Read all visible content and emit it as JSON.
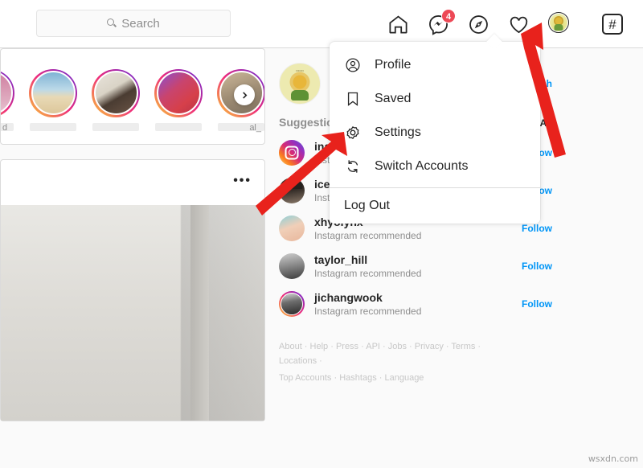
{
  "navbar": {
    "search": {
      "placeholder": "Search",
      "value": "",
      "icon": "search-icon"
    },
    "icons": [
      {
        "name": "home-icon",
        "label": "Home"
      },
      {
        "name": "messenger-icon",
        "label": "Messages",
        "badge": "4"
      },
      {
        "name": "compass-icon",
        "label": "Explore"
      },
      {
        "name": "heart-icon",
        "label": "Activity"
      },
      {
        "name": "profile-avatar",
        "label": "Profile"
      }
    ],
    "hashtag_button": "#"
  },
  "dropdown": {
    "items": [
      {
        "label": "Profile",
        "icon": "person-circle-icon"
      },
      {
        "label": "Saved",
        "icon": "bookmark-icon"
      },
      {
        "label": "Settings",
        "icon": "gear-icon"
      },
      {
        "label": "Switch Accounts",
        "icon": "switch-arrows-icon"
      }
    ],
    "logout": "Log Out"
  },
  "stories": {
    "items": [
      {
        "username": ""
      },
      {
        "username": ""
      },
      {
        "username": ""
      },
      {
        "username": ""
      },
      {
        "username": ""
      }
    ],
    "edge_left_text": "d",
    "edge_right_text": "al_",
    "next_icon": "chevron-right-icon"
  },
  "post": {
    "more_label": "•••"
  },
  "sidebar": {
    "me": {
      "username": "",
      "fullname": "",
      "switch_label": "Switch"
    },
    "suggestions": {
      "title": "Suggestions For You",
      "see_all": "See All",
      "rows": [
        {
          "username": "instagram",
          "subtitle": "Instagram Official Account",
          "action": "Follow",
          "avatar": "instagram-logo-avatar",
          "ring": false
        },
        {
          "username": "icecube",
          "subtitle": "Instagram recommended",
          "action": "Follow",
          "avatar": "icecube-avatar",
          "ring": false
        },
        {
          "username": "xhyolynx",
          "subtitle": "Instagram recommended",
          "action": "Follow",
          "avatar": "xhyolynx-avatar",
          "ring": false
        },
        {
          "username": "taylor_hill",
          "subtitle": "Instagram recommended",
          "action": "Follow",
          "avatar": "taylor-hill-avatar",
          "ring": false
        },
        {
          "username": "jichangwook",
          "subtitle": "Instagram recommended",
          "action": "Follow",
          "avatar": "jichangwook-avatar",
          "ring": true
        }
      ]
    },
    "footer": {
      "line1": [
        "About",
        "Help",
        "Press",
        "API",
        "Jobs",
        "Privacy",
        "Terms",
        "Locations"
      ],
      "line2": [
        "Top Accounts",
        "Hashtags",
        "Language"
      ],
      "separator": " · "
    }
  },
  "annotations": {
    "arrow_color": "#e8221c",
    "arrow_to_avatar": "points at profile avatar in navbar",
    "arrow_to_settings": "points at Settings menu item"
  },
  "watermark": "wsxdn.com",
  "colors": {
    "link_blue": "#0095f6",
    "text_primary": "#262626",
    "text_secondary": "#8e8e8e",
    "badge_red": "#ed4956",
    "page_bg": "#fafafa",
    "border": "#dbdbdb"
  }
}
